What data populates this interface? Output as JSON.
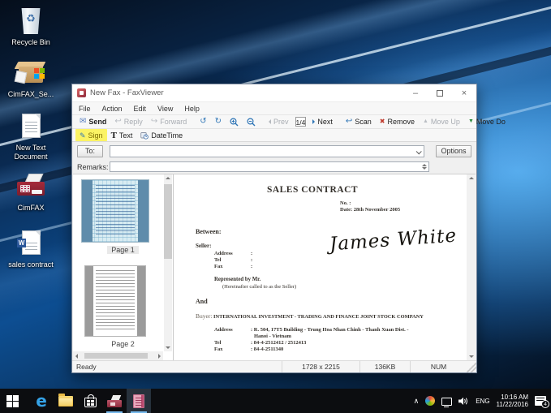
{
  "desktop": {
    "icons": [
      {
        "label": "Recycle Bin"
      },
      {
        "label": "CimFAX_Se..."
      },
      {
        "label": "New Text Document"
      },
      {
        "label": "CimFAX"
      },
      {
        "label": "sales contract"
      }
    ]
  },
  "window": {
    "title": "New Fax - FaxViewer",
    "menu": [
      "File",
      "Action",
      "Edit",
      "View",
      "Help"
    ],
    "toolbar": {
      "send": "Send",
      "reply": "Reply",
      "forward": "Forward",
      "prev": "Prev",
      "page": "1/4",
      "next": "Next",
      "scan": "Scan",
      "remove": "Remove",
      "move_up": "Move Up",
      "move_down": "Move Do"
    },
    "annotate": {
      "sign": "Sign",
      "text": "Text",
      "datetime": "DateTime"
    },
    "recipient": {
      "to": "To:",
      "to_value": "",
      "options": "Options",
      "remarks": "Remarks:",
      "remarks_value": ""
    },
    "thumbnails": [
      {
        "label": "Page 1"
      },
      {
        "label": "Page 2"
      }
    ],
    "doc": {
      "title": "SALES CONTRACT",
      "no_line": "No.  :",
      "date_line": "Date: 28th November 2005",
      "between": "Between:",
      "seller": "Seller:",
      "seller_rows": [
        {
          "name": "Address",
          "value": ":"
        },
        {
          "name": "Tel",
          "value": ":"
        },
        {
          "name": "Fax",
          "value": ":"
        }
      ],
      "signature": "James White",
      "represented": "Represented by Mr.",
      "hereinafter": "(Hereinafter called to as the Seller)",
      "and": "And",
      "buyer_label": "Buyer:",
      "buyer_name": "INTERNATIONAL INVESTMENT - TRADING AND FINANCE JOINT STOCK COMPANY",
      "buyer_rows": [
        {
          "name": "Address",
          "value": ": R. 504, 17T5 Building - Trung Hoa Nhan Chinh - Thanh Xuan Dist. -"
        },
        {
          "name": "",
          "value": "Hanoi - Vietnam"
        },
        {
          "name": "Tel",
          "value": ": 84-4-2512412 / 2512413"
        },
        {
          "name": "Fax",
          "value": ": 84-4-2511340"
        }
      ]
    },
    "status": {
      "ready": "Ready",
      "dimensions": "1728 x 2215",
      "size": "136KB",
      "num": "NUM"
    },
    "controls": {
      "minimize": "–",
      "close": "×"
    }
  },
  "taskbar": {
    "tray": {
      "lang": "ENG",
      "time": "10:16 AM",
      "date": "11/22/2016",
      "badge": "4"
    }
  },
  "glyphs": {
    "send": "✉",
    "reply": "↩",
    "forward": "↪",
    "rotate_left": "↺",
    "rotate_right": "↻",
    "scan": "↩",
    "remove": "✖",
    "move_up": "▲",
    "move_down": "▼",
    "sign": "✎",
    "text": "T",
    "recycle": "♻",
    "chevron_up": "∧",
    "w": "W"
  }
}
